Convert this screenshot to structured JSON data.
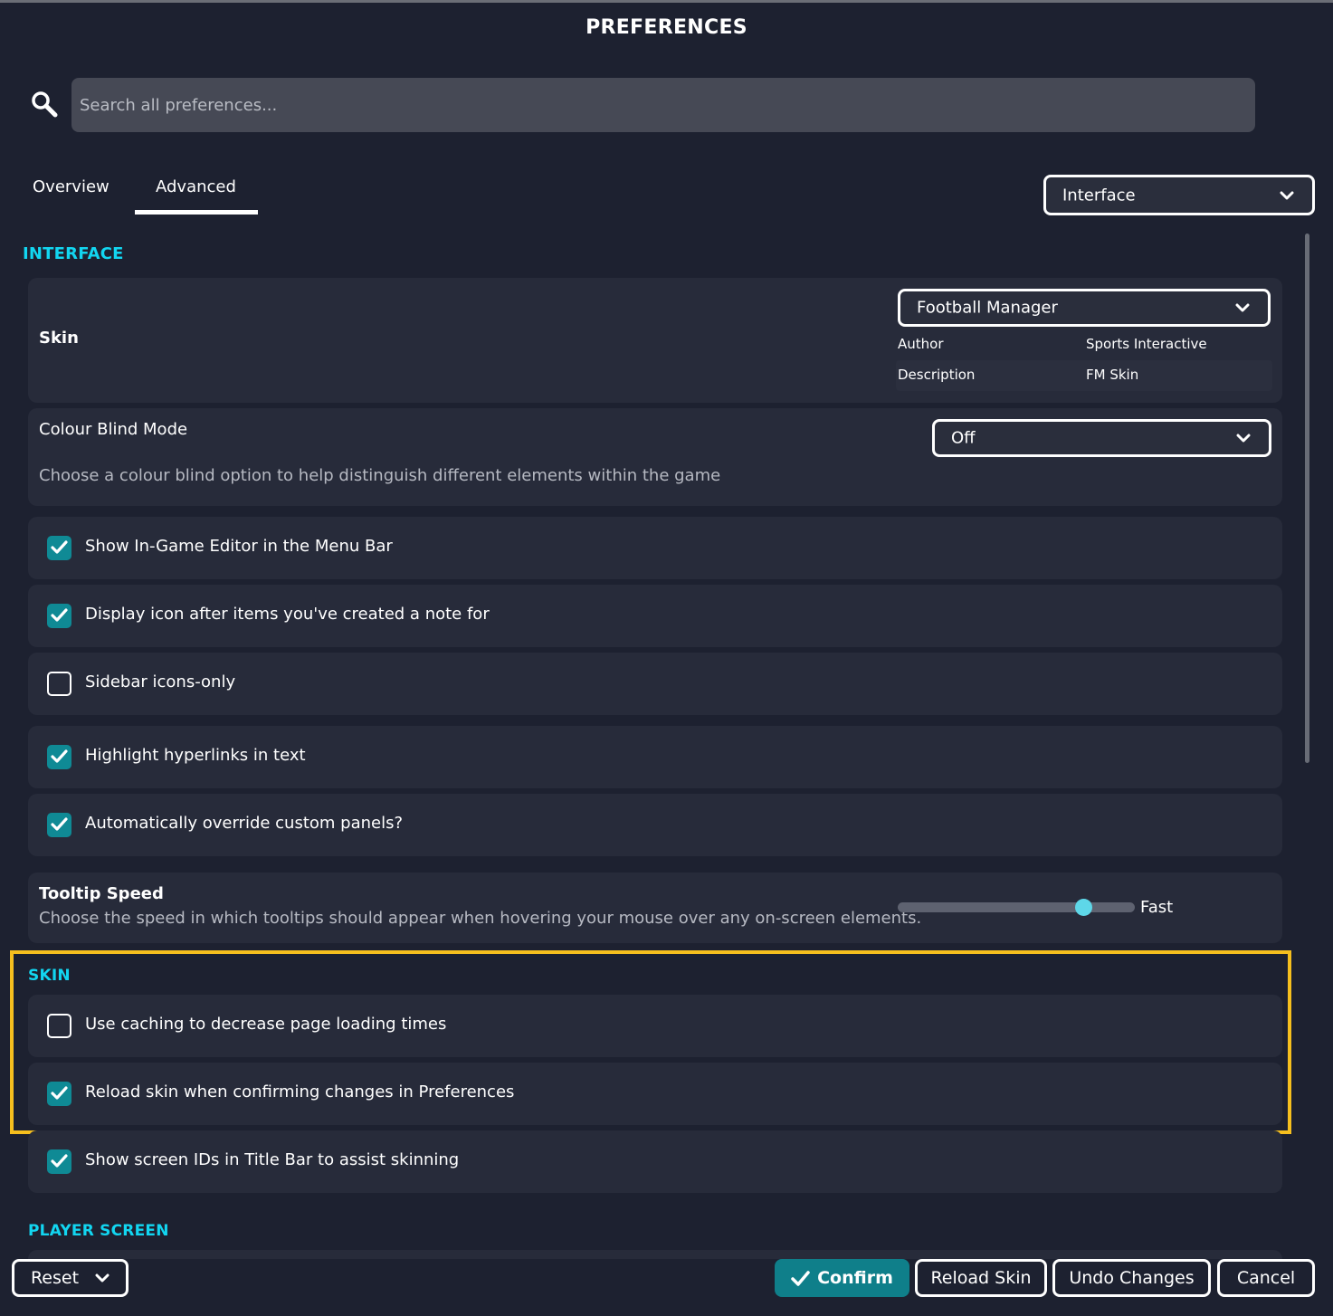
{
  "window": {
    "title": "PREFERENCES"
  },
  "search": {
    "placeholder": "Search all preferences..."
  },
  "tabs": [
    {
      "label": "Overview",
      "active": false
    },
    {
      "label": "Advanced",
      "active": true
    }
  ],
  "category_dropdown": {
    "value": "Interface"
  },
  "sections": {
    "interface": "INTERFACE",
    "skin": "SKIN",
    "player_screen": "PLAYER SCREEN"
  },
  "skin_setting": {
    "label": "Skin",
    "value": "Football Manager",
    "author_label": "Author",
    "author_value": "Sports Interactive",
    "description_label": "Description",
    "description_value": "FM Skin"
  },
  "colour_blind": {
    "label": "Colour Blind Mode",
    "description": "Choose a colour blind option to help distinguish different elements within the game",
    "value": "Off"
  },
  "interface_checkboxes": [
    {
      "label": "Show In-Game Editor in the Menu Bar",
      "checked": true
    },
    {
      "label": "Display icon after items you've created a note for",
      "checked": true
    },
    {
      "label": "Sidebar icons-only",
      "checked": false
    },
    {
      "label": "Highlight hyperlinks in text",
      "checked": true
    },
    {
      "label": "Automatically override custom panels?",
      "checked": true
    }
  ],
  "tooltip_speed": {
    "label": "Tooltip Speed",
    "description": "Choose the speed in which tooltips should appear when hovering your mouse over any on-screen elements.",
    "value_label": "Fast",
    "level": 0.79
  },
  "skin_checkboxes": [
    {
      "label": "Use caching to decrease page loading times",
      "checked": false
    },
    {
      "label": "Reload skin when confirming changes in Preferences",
      "checked": true
    },
    {
      "label": "Show screen IDs in Title Bar to assist skinning",
      "checked": true
    }
  ],
  "buttons": {
    "reset": "Reset",
    "confirm": "Confirm",
    "reload_skin": "Reload Skin",
    "undo_changes": "Undo Changes",
    "cancel": "Cancel"
  },
  "colors": {
    "background": "#1d2130",
    "panel": "#272b3a",
    "accent": "#12d6f1",
    "checkbox": "#0f8a95",
    "highlight": "#f6bf1e",
    "confirm": "#0f7f8a"
  },
  "icons": {
    "search": "search-icon",
    "dropdown": "chevron-down-icon",
    "check": "checkmark-icon"
  }
}
